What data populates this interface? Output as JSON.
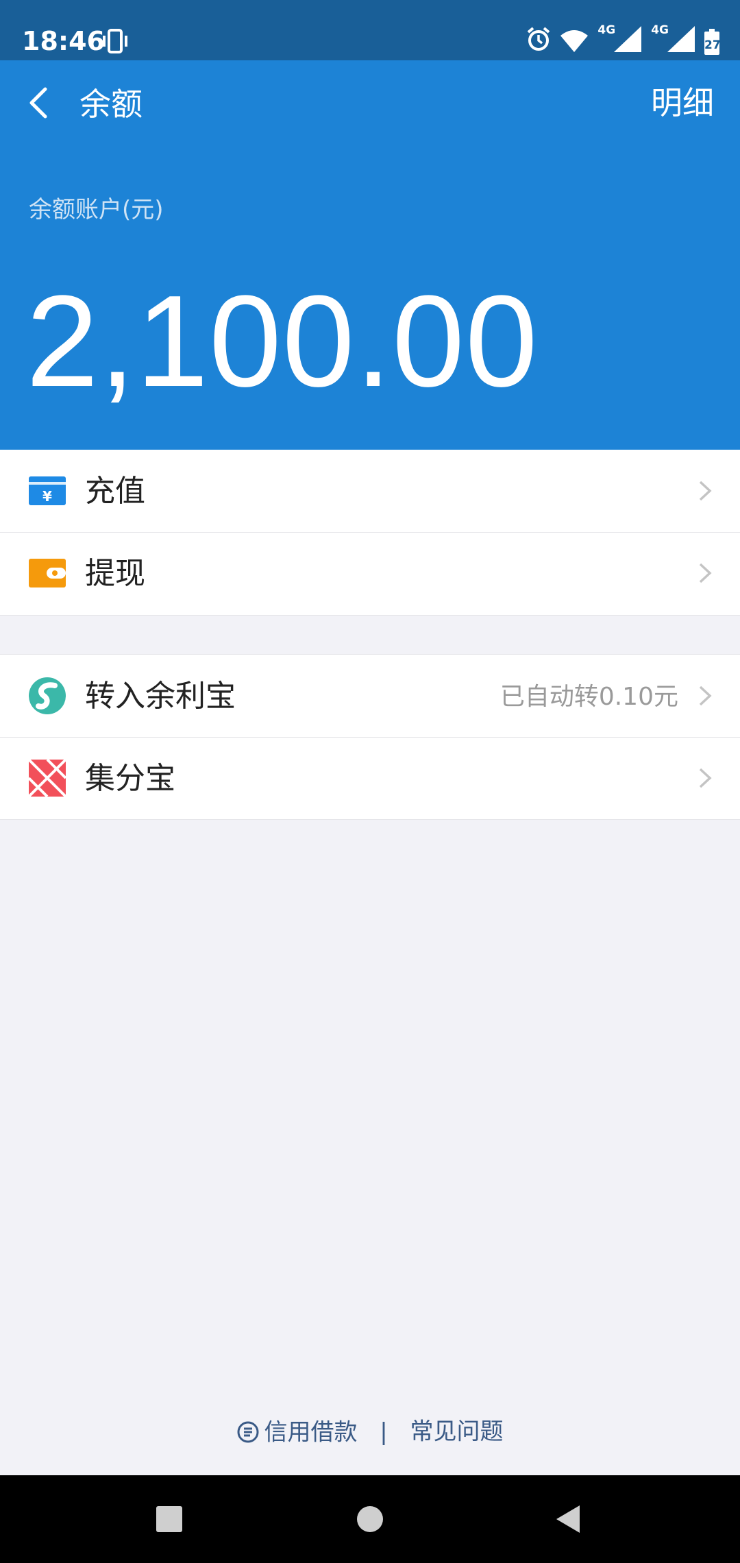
{
  "status_bar": {
    "time": "18:46",
    "network_1": "4G",
    "network_2": "4G",
    "battery": "27"
  },
  "header": {
    "title": "余额",
    "detail_label": "明细",
    "account_label": "余额账户(元)",
    "balance": "2,100.00",
    "background_color": "#1d83d6"
  },
  "actions": [
    {
      "label": "充值",
      "icon": "recharge-icon"
    },
    {
      "label": "提现",
      "icon": "wallet-icon"
    }
  ],
  "services": [
    {
      "label": "转入余利宝",
      "value": "已自动转0.10元",
      "icon": "yulibao-icon"
    },
    {
      "label": "集分宝",
      "value": "",
      "icon": "jifenbao-icon"
    }
  ],
  "footer": {
    "loan_label": "信用借款",
    "separator": "|",
    "faq_label": "常见问题"
  }
}
